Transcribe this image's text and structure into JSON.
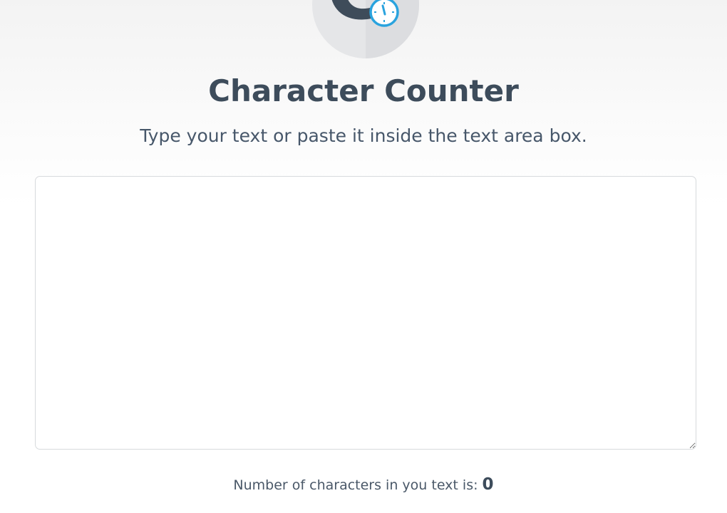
{
  "logo": {
    "letter": "C",
    "icon": "stopwatch-icon",
    "icon_color": "#2aa3de"
  },
  "header": {
    "title": "Character Counter",
    "subtitle": "Type your text or paste it inside the text area box."
  },
  "editor": {
    "value": "",
    "placeholder": ""
  },
  "result": {
    "label": "Number of characters in you text is:",
    "count": "0"
  },
  "colors": {
    "text_dark": "#3d4c5b",
    "accent": "#2aa3de",
    "border": "#d7dadd"
  }
}
